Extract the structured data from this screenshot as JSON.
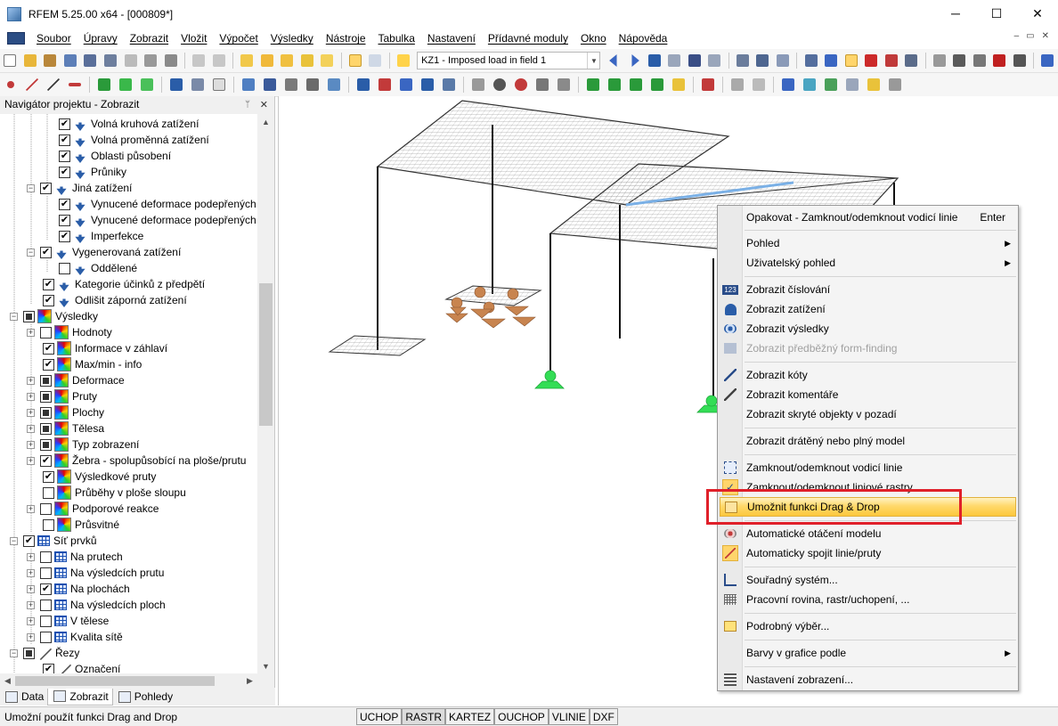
{
  "window": {
    "title": "RFEM 5.25.00 x64 - [000809*]",
    "minimize_glyph": "─",
    "maximize_glyph": "☐",
    "close_glyph": "✕"
  },
  "menubar": {
    "items": [
      "Soubor",
      "Úpravy",
      "Zobrazit",
      "Vložit",
      "Výpočet",
      "Výsledky",
      "Nástroje",
      "Tabulka",
      "Nastavení",
      "Přídavné moduly",
      "Okno",
      "Nápověda"
    ],
    "mdi_controls": [
      "‒",
      "▭",
      "✕"
    ]
  },
  "toolbar1": {
    "load_case_combo": "KZ1 - Imposed load in field 1"
  },
  "navigator": {
    "title": "Navigátor projektu - Zobrazit",
    "pin_glyph": "ᛘ",
    "close_glyph": "✕",
    "tree": [
      {
        "label": "Volná kruhová zatížení",
        "checked": "✔"
      },
      {
        "label": "Volná proměnná zatížení",
        "checked": "✔"
      },
      {
        "label": "Oblasti působení",
        "checked": "✔"
      },
      {
        "label": "Průniky",
        "checked": "✔"
      },
      {
        "label": "Jiná zatížení",
        "checked": "✔"
      },
      {
        "label": "Vynucené deformace podepřených",
        "checked": "✔"
      },
      {
        "label": "Vynucené deformace podepřených",
        "checked": "✔"
      },
      {
        "label": "Imperfekce",
        "checked": "✔"
      },
      {
        "label": "Vygenerovaná zatížení",
        "checked": "✔"
      },
      {
        "label": "Oddělené",
        "checked": ""
      },
      {
        "label": "Kategorie účinků z předpětí",
        "checked": "✔"
      },
      {
        "label": "Odlišit zápornά zatížení",
        "checked": "✔"
      },
      {
        "label": "Výsledky",
        "checked": ""
      },
      {
        "label": "Hodnoty",
        "checked": ""
      },
      {
        "label": "Informace v záhlaví",
        "checked": "✔"
      },
      {
        "label": "Max/min - info",
        "checked": "✔"
      },
      {
        "label": "Deformace",
        "checked": ""
      },
      {
        "label": "Pruty",
        "checked": ""
      },
      {
        "label": "Plochy",
        "checked": ""
      },
      {
        "label": "Tělesa",
        "checked": ""
      },
      {
        "label": "Typ zobrazení",
        "checked": ""
      },
      {
        "label": "Žebra - spolupůsobící na ploše/prutu",
        "checked": "✔"
      },
      {
        "label": "Výsledkové pruty",
        "checked": "✔"
      },
      {
        "label": "Průběhy v ploše sloupu",
        "checked": ""
      },
      {
        "label": "Podporové reakce",
        "checked": ""
      },
      {
        "label": "Průsvitné",
        "checked": ""
      },
      {
        "label": "Síť prvků",
        "checked": "✔"
      },
      {
        "label": "Na prutech",
        "checked": ""
      },
      {
        "label": "Na výsledcích prutu",
        "checked": ""
      },
      {
        "label": "Na plochách",
        "checked": "✔"
      },
      {
        "label": "Na výsledcích ploch",
        "checked": ""
      },
      {
        "label": "V tělese",
        "checked": ""
      },
      {
        "label": "Kvalita sítě",
        "checked": ""
      },
      {
        "label": "Řezy",
        "checked": ""
      },
      {
        "label": "Označení",
        "checked": "✔"
      }
    ],
    "tabs": [
      "Data",
      "Zobrazit",
      "Pohledy"
    ]
  },
  "context_menu": {
    "items": [
      {
        "label": "Opakovat - Zamknout/odemknout vodicí linie",
        "shortcut": "Enter"
      },
      {
        "label": "Pohled",
        "submenu": "▶"
      },
      {
        "label": "Uživatelský pohled",
        "submenu": "▶"
      },
      {
        "label": "Zobrazit číslování",
        "icon_text": "123"
      },
      {
        "label": "Zobrazit zatížení"
      },
      {
        "label": "Zobrazit výsledky"
      },
      {
        "label": "Zobrazit předběžný form-finding"
      },
      {
        "label": "Zobrazit kóty"
      },
      {
        "label": "Zobrazit komentáře"
      },
      {
        "label": "Zobrazit skryté objekty v pozadí"
      },
      {
        "label": "Zobrazit drátěný nebo plný model"
      },
      {
        "label": "Zamknout/odemknout vodicí linie"
      },
      {
        "label": "Zamknout/odemknout liniové rastry",
        "check_glyph": "✓"
      },
      {
        "label": "Umožnit funkci Drag & Drop"
      },
      {
        "label": "Automatické otáčení modelu"
      },
      {
        "label": "Automaticky spojit linie/pruty"
      },
      {
        "label": "Souřadný systém..."
      },
      {
        "label": "Pracovní rovina, rastr/uchopení, ..."
      },
      {
        "label": "Podrobný výběr..."
      },
      {
        "label": "Barvy v grafice podle",
        "submenu": "▶"
      },
      {
        "label": "Nastavení zobrazení..."
      }
    ]
  },
  "statusbar": {
    "text": "Umožní použít funkci Drag and Drop",
    "buttons": [
      "UCHOP",
      "RASTR",
      "KARTEZ",
      "OUCHOP",
      "VLINIE",
      "DXF"
    ]
  },
  "colors": {
    "highlight_box": "#e0202a",
    "menu_highlight": "#ffd96b",
    "support": "#33dd55",
    "load_brown": "#c8844f"
  }
}
